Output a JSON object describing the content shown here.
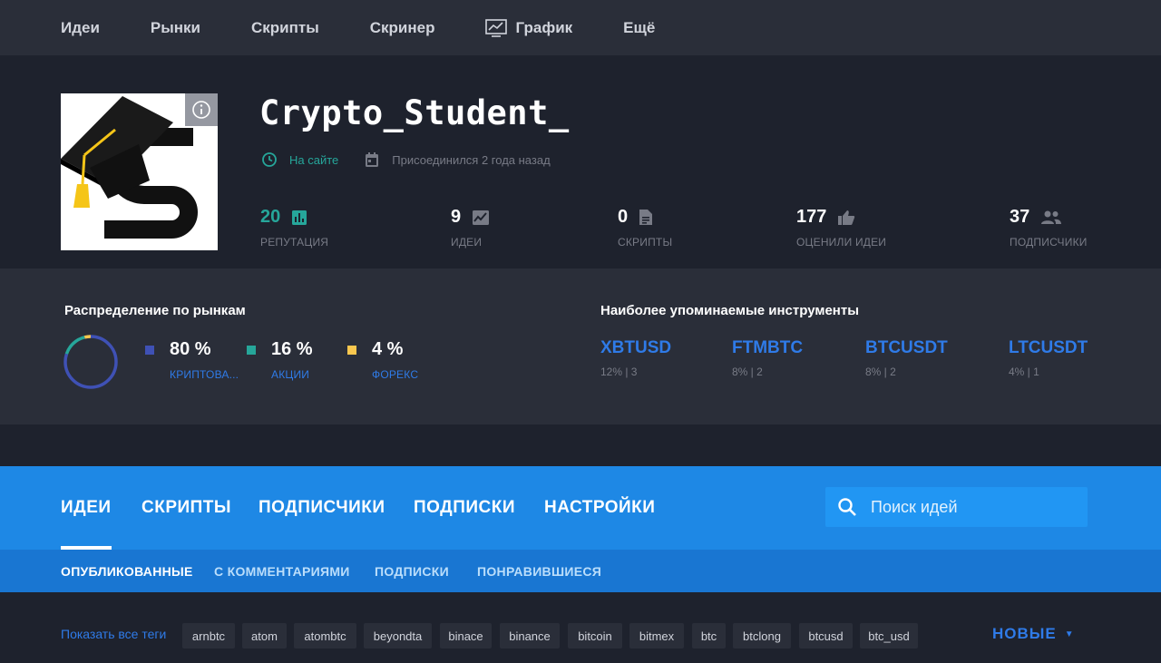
{
  "topnav": {
    "items": [
      "Идеи",
      "Рынки",
      "Скрипты",
      "Скринер",
      "График",
      "Ещё"
    ]
  },
  "profile": {
    "username": "Crypto_Student_",
    "online": "На сайте",
    "joined": "Присоединился 2 года назад",
    "stats": [
      {
        "value": "20",
        "label": "РЕПУТАЦИЯ",
        "icon": "reputation-chart-icon"
      },
      {
        "value": "9",
        "label": "ИДЕИ",
        "icon": "ideas-chart-icon"
      },
      {
        "value": "0",
        "label": "СКРИПТЫ",
        "icon": "script-doc-icon"
      },
      {
        "value": "177",
        "label": "ОЦЕНИЛИ ИДЕИ",
        "icon": "thumb-up-icon"
      },
      {
        "value": "37",
        "label": "ПОДПИСЧИКИ",
        "icon": "people-icon"
      }
    ]
  },
  "markets": {
    "title": "Распределение по рынкам",
    "items": [
      {
        "pct": "80 %",
        "name": "КРИПТОВА...",
        "color": "#3f51b5",
        "value": 80
      },
      {
        "pct": "16 %",
        "name": "АКЦИИ",
        "color": "#26a69a",
        "value": 16
      },
      {
        "pct": "4 %",
        "name": "ФОРЕКС",
        "color": "#f9c74f",
        "value": 4
      }
    ]
  },
  "instruments": {
    "title": "Наиболее упоминаемые инструменты",
    "items": [
      {
        "symbol": "XBTUSD",
        "meta": "12% | 3"
      },
      {
        "symbol": "FTMBTC",
        "meta": "8% | 2"
      },
      {
        "symbol": "BTCUSDT",
        "meta": "8% | 2"
      },
      {
        "symbol": "LTCUSDT",
        "meta": "4% | 1"
      }
    ]
  },
  "tabs": {
    "items": [
      "ИДЕИ",
      "СКРИПТЫ",
      "ПОДПИСЧИКИ",
      "ПОДПИСКИ",
      "НАСТРОЙКИ"
    ],
    "search_placeholder": "Поиск идей"
  },
  "subtabs": {
    "items": [
      "ОПУБЛИКОВАННЫЕ",
      "С КОММЕНТАРИЯМИ",
      "ПОДПИСКИ",
      "ПОНРАВИВШИЕСЯ"
    ]
  },
  "tags": {
    "show_all": "Показать все теги",
    "items": [
      "arnbtc",
      "atom",
      "atombtc",
      "beyondta",
      "binace",
      "binance",
      "bitcoin",
      "bitmex",
      "btc",
      "btclong",
      "btcusd",
      "btc_usd"
    ],
    "sort_label": "НОВЫЕ"
  },
  "colors": {
    "accent_blue": "#1e88e5",
    "link_blue": "#2f7be8",
    "online_green": "#26a69a",
    "background": "#1e222d",
    "panel": "#2a2e39"
  }
}
